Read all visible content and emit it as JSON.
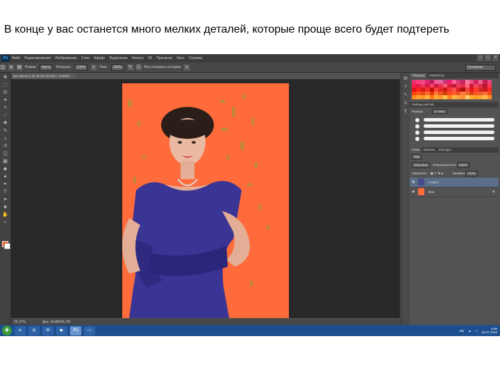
{
  "caption": "В конце у вас останется много мелких деталей, которые проще всего будет подтереть",
  "app": {
    "logo": "Ps",
    "menu": [
      "Файл",
      "Редактирование",
      "Изображение",
      "Слои",
      "Шрифт",
      "Выделение",
      "Фильтр",
      "3D",
      "Просмотр",
      "Окно",
      "Справка"
    ],
    "window_controls": [
      "–",
      "□",
      "×"
    ]
  },
  "options_bar": {
    "mode_label": "Режим:",
    "mode_value": "Кисть",
    "opacity_label": "Непрозр.:",
    "opacity_value": "100%",
    "press_label": "Наж.:",
    "press_value": "100%",
    "restore_label": "Восстановить историю",
    "workspace": "Основная"
  },
  "document": {
    "tab_title": "Без имени-1 @ 25,3% (Слой 1, RGB/8) *",
    "zoom": "25,27%",
    "doc_info": "Док: 34,8M/35,7M",
    "background_color": "#ff6b3a"
  },
  "panels": {
    "swatches_tabs": [
      "Образцы",
      "Навигатор"
    ],
    "swatches_colors": [
      "#e8306f",
      "#ff3a7a",
      "#f24a8a",
      "#d9266b",
      "#b51e5a",
      "#f05a9a",
      "#e0669f",
      "#c8387c",
      "#ee1f6e",
      "#ff5f95",
      "#d83a70",
      "#bf2b60",
      "#f7789f",
      "#ea4f83",
      "#d02159",
      "#f0618f",
      "#c51e54",
      "#e5467a",
      "#ff1a4d",
      "#e01e4a",
      "#f23559",
      "#d51a44",
      "#ff4466",
      "#c8163b",
      "#ee2b50",
      "#ff5a75",
      "#d9223f",
      "#b81934",
      "#f03a5a",
      "#e82a4c",
      "#ff6a80",
      "#cc1a3a",
      "#f2485f",
      "#de2e49",
      "#b8172f",
      "#ff3550",
      "#e01020",
      "#ff2020",
      "#d41c1c",
      "#f23030",
      "#c41010",
      "#ff4040",
      "#e62a2a",
      "#cc1818",
      "#f53535",
      "#ff5050",
      "#db2222",
      "#b01010",
      "#f04545",
      "#e51919",
      "#ff3a2a",
      "#d42a2a",
      "#c81c1c",
      "#ff2a2a",
      "#ff3d0d",
      "#ff5a1a",
      "#ee4a10",
      "#ff6a2a",
      "#e63a08",
      "#ff7a3a",
      "#f0551a",
      "#d83a08",
      "#ff4a20",
      "#ff6030",
      "#e85020",
      "#ff8040",
      "#f26a2a",
      "#db4410",
      "#ff552a",
      "#e8602a",
      "#ff703a",
      "#f24a1a",
      "#ff8a1a",
      "#ffa030",
      "#ff9520",
      "#ffb040",
      "#ff7a10",
      "#ffaa35",
      "#ff9a2a",
      "#ffc050",
      "#ff8520",
      "#ffb545",
      "#ffa540",
      "#ff9030",
      "#ffc860",
      "#ffb030",
      "#ff9c25",
      "#ffa838",
      "#ffbb48",
      "#ff8c28"
    ],
    "brushes_title": "Наборы кистей",
    "brush_size_label": "Размер:",
    "brush_size_value": "17 пикс.",
    "layers_tabs": [
      "Слои",
      "Каналы",
      "Контуры"
    ],
    "layers_kind": "Вид",
    "blend_mode": "Обычные",
    "opacity_label": "Непрозрачность:",
    "opacity_value": "100%",
    "lock_label": "Закрепить:",
    "fill_label": "Заливка:",
    "fill_value": "100%",
    "layers": [
      {
        "name": "Слой 1",
        "selected": true,
        "thumb": "#4a4a8a"
      },
      {
        "name": "Фон",
        "selected": false,
        "thumb": "#ff6b3a"
      }
    ]
  },
  "taskbar": {
    "apps": [
      "explorer-icon",
      "chrome-icon",
      "outlook-icon",
      "windows-media-icon",
      "photoshop-icon",
      "folder-icon"
    ],
    "active_app": "Ps",
    "language": "EN",
    "time": "0:00",
    "date": "15.07.2016"
  }
}
